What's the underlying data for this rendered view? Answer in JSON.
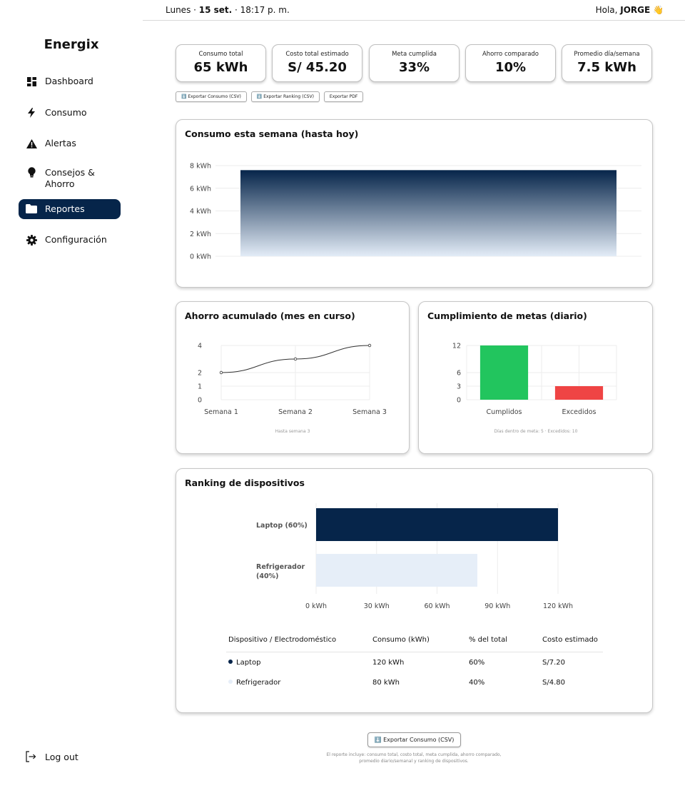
{
  "app": {
    "name": "Energix"
  },
  "topbar": {
    "day": "Lunes · ",
    "date": "15 set.",
    "time": " · 18:17 p. m.",
    "greeting": "Hola, ",
    "user": "JORGE",
    "wave_emoji": "👋"
  },
  "sidebar": {
    "items": [
      {
        "label": "Dashboard",
        "icon": "dashboard-icon"
      },
      {
        "label": "Consumo",
        "icon": "bolt-icon"
      },
      {
        "label": "Alertas",
        "icon": "warning-icon"
      },
      {
        "label": "Consejos &",
        "label2": "Ahorro",
        "icon": "lightbulb-icon"
      },
      {
        "label": "Reportes",
        "icon": "folder-icon",
        "active": true
      },
      {
        "label": "Configuración",
        "icon": "gear-icon"
      }
    ],
    "logout": "Log out"
  },
  "kpis": [
    {
      "title": "Consumo total",
      "value": "65 kWh"
    },
    {
      "title": "Costo total estimado",
      "value": "S/ 45.20"
    },
    {
      "title": "Meta cumplida",
      "value": "33%"
    },
    {
      "title": "Ahorro comparado",
      "value": "10%"
    },
    {
      "title": "Promedio día/semana",
      "value": "7.5 kWh"
    }
  ],
  "export_buttons": {
    "consumo": "⬇️ Exportar Consumo (CSV)",
    "ranking": "⬇️ Exportar Ranking (CSV)",
    "pdf": "Exportar PDF"
  },
  "weekly_card": {
    "title": "Consumo esta semana (hasta hoy)"
  },
  "savings_card": {
    "title": "Ahorro acumulado (mes en curso)",
    "caption": "Hasta semana 3"
  },
  "goals_card": {
    "title": "Cumplimiento de metas (diario)",
    "caption": "Días dentro de meta: 5 · Excedidos: 10"
  },
  "ranking_card": {
    "title": "Ranking de dispositivos",
    "table": {
      "headers": [
        "Dispositivo / Electrodoméstico",
        "Consumo (kWh)",
        "% del total",
        "Costo estimado"
      ],
      "rows": [
        {
          "device": "Laptop",
          "consumo": "120 kWh",
          "pct": "60%",
          "costo": "S/7.20"
        },
        {
          "device": "Refrigerador",
          "consumo": "80 kWh",
          "pct": "40%",
          "costo": "S/4.80"
        }
      ]
    }
  },
  "footer": {
    "button": "⬇️ Exportar Consumo (CSV)",
    "note_line1": "El reporte incluye: consumo total, costo total, meta cumplida, ahorro comparado,",
    "note_line2": "promedio diario/semanal y ranking de dispositivos."
  },
  "colors": {
    "navy": "#06254a",
    "green": "#22c55e",
    "red": "#ef4444",
    "light_blue": "#e6eef8"
  },
  "chart_data": [
    {
      "type": "bar",
      "title": "Consumo esta semana (hasta hoy)",
      "categories": [
        ""
      ],
      "values": [
        7.6
      ],
      "ylim": [
        0,
        8
      ],
      "yticks": [
        "0 kWh",
        "2 kWh",
        "4 kWh",
        "6 kWh",
        "8 kWh"
      ],
      "ytick_values": [
        0,
        2,
        4,
        6,
        8
      ]
    },
    {
      "type": "line",
      "title": "Ahorro acumulado (mes en curso)",
      "categories": [
        "Semana 1",
        "Semana 2",
        "Semana 3"
      ],
      "values": [
        2,
        3,
        4
      ],
      "ylim": [
        0,
        4
      ],
      "yticks": [
        "0",
        "1",
        "2",
        "4"
      ],
      "ytick_values": [
        0,
        1,
        2,
        4
      ]
    },
    {
      "type": "bar",
      "title": "Cumplimiento de metas (diario)",
      "categories": [
        "Cumplidos",
        "Excedidos"
      ],
      "values": [
        12,
        3
      ],
      "ylim": [
        0,
        12
      ],
      "yticks": [
        "0",
        "3",
        "6",
        "12"
      ],
      "ytick_values": [
        0,
        3,
        6,
        12
      ]
    },
    {
      "type": "bar",
      "orientation": "horizontal",
      "title": "Ranking de dispositivos",
      "categories": [
        "Laptop (60%)",
        "Refrigerador (40%)"
      ],
      "values": [
        120,
        80
      ],
      "xlim": [
        0,
        120
      ],
      "xticks": [
        "0 kWh",
        "30 kWh",
        "60 kWh",
        "90 kWh",
        "120 kWh"
      ],
      "xtick_values": [
        0,
        30,
        60,
        90,
        120
      ]
    }
  ]
}
